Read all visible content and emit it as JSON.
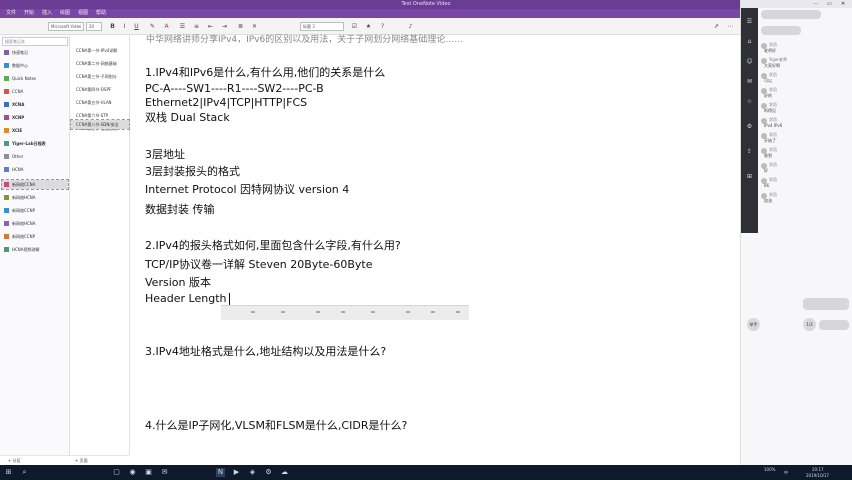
{
  "titlebar": {
    "title": "Test OneNote Video",
    "minimize": "–",
    "maximize": "□",
    "close": "✕"
  },
  "ribbon_tabs": [
    "文件",
    "开始",
    "插入",
    "绘图",
    "视图",
    "帮助"
  ],
  "toolbar": {
    "font": "Microsoft YaHei",
    "size": "20",
    "bold": "B",
    "italic": "I",
    "underline": "U",
    "style": "标题 3"
  },
  "notebooks": {
    "search_placeholder": "搜索笔记本",
    "items": [
      {
        "label": "快速笔记",
        "color": "#7b5fb0"
      },
      {
        "label": "数据中心",
        "color": "#3a8fd1"
      },
      {
        "label": "Quick Notes",
        "color": "#5bab58"
      },
      {
        "label": "CCNA",
        "color": "#d4574c"
      },
      {
        "label": "XCNA",
        "color": "#3b6fb6"
      },
      {
        "label": "XCNP",
        "color": "#a24a9c"
      },
      {
        "label": "XCIE",
        "color": "#e08a2b"
      },
      {
        "label": "Yiger-Lab日程表",
        "color": "#4d9a8a"
      },
      {
        "label": "Other",
        "color": "#8f8f8f"
      },
      {
        "label": "HCNA",
        "color": "#5a7fc8"
      },
      {
        "label": "新网络CCNA",
        "color": "#c44f7a"
      },
      {
        "label": "新网络HCNA",
        "color": "#7a9a3b"
      },
      {
        "label": "新网络CCNP",
        "color": "#3a8fd1"
      },
      {
        "label": "新网络HCNA",
        "color": "#8a5cc4"
      },
      {
        "label": "新网络CCNP",
        "color": "#cf7b35"
      },
      {
        "label": "HCNA视频讲解",
        "color": "#4a9a6a"
      }
    ]
  },
  "pages": {
    "items": [
      "CCNA第一节-IPv4详解",
      "CCNA第二节-网络基础",
      "CCNA第三节-子网划分",
      "CCNA第四节-OSPF",
      "CCNA第五节-VLAN",
      "CCNA第六节-STP",
      "CCNA第七节-路由协议",
      "CCNA第八节-SDN/安全"
    ]
  },
  "bottombar": {
    "add_section": "+ 分区",
    "add_page": "+ 页面"
  },
  "note": {
    "top_clip": "中华网络讲师分享IPv4，IPv6的区别以及用法，关于子网划分网络基础理论……",
    "lines": [
      "1.IPv4和IPv6是什么,有什么用,他们的关系是什么",
      "PC-A----SW1----R1----SW2----PC-B",
      "Ethernet2|IPv4|TCP|HTTP|FCS",
      "双栈 Dual Stack",
      "3层地址",
      "3层封装报头的格式",
      "Internet Protocol 因特网协议 version 4",
      "数据封装 传输",
      "2.IPv4的报头格式如何,里面包含什么字段,有什么用?",
      "TCP/IP协议卷一详解 Steven  20Byte-60Byte",
      "Version 版本",
      "Header Length",
      "3.IPv4地址格式是什么,地址结构以及用法是什么?",
      "4.什么是IP子网化,VLSM和FLSM是什么,CIDR是什么?"
    ]
  },
  "chat": {
    "header_icons": [
      "⋯",
      "▭",
      "✕"
    ],
    "rail_icons": [
      "☰",
      "⌂",
      "☺",
      "✉",
      "☆",
      "⚙",
      "⇪",
      "⊞"
    ],
    "messages": [
      {
        "name": "学员",
        "text": "老师好"
      },
      {
        "name": "Yiger老师",
        "text": "大家好啊"
      },
      {
        "name": "学员",
        "text": "可以"
      },
      {
        "name": "学员",
        "text": "好的"
      },
      {
        "name": "学员",
        "text": "听得见"
      },
      {
        "name": "学员",
        "text": "IPv4 IPv6"
      },
      {
        "name": "学员",
        "text": "开始了"
      },
      {
        "name": "学员",
        "text": "收到"
      },
      {
        "name": "学员",
        "text": "好"
      },
      {
        "name": "学员",
        "text": "66"
      },
      {
        "name": "学员",
        "text": "加油"
      }
    ],
    "raise_label": "举手",
    "count_label": "1/3"
  },
  "taskbar": {
    "start": "⊞",
    "icons": [
      "⌕",
      "▢",
      "◉",
      "▣",
      "✉",
      "N",
      "▶",
      "◈",
      "⚙",
      "☁"
    ],
    "clock_time": "20:17",
    "clock_date": "2019/10/17",
    "lang": "中",
    "battery": "100%"
  },
  "colors": {
    "title_purple": "#6a3c93",
    "ribbon_purple": "#7a46a6",
    "taskbar": "#0e1a2b"
  }
}
